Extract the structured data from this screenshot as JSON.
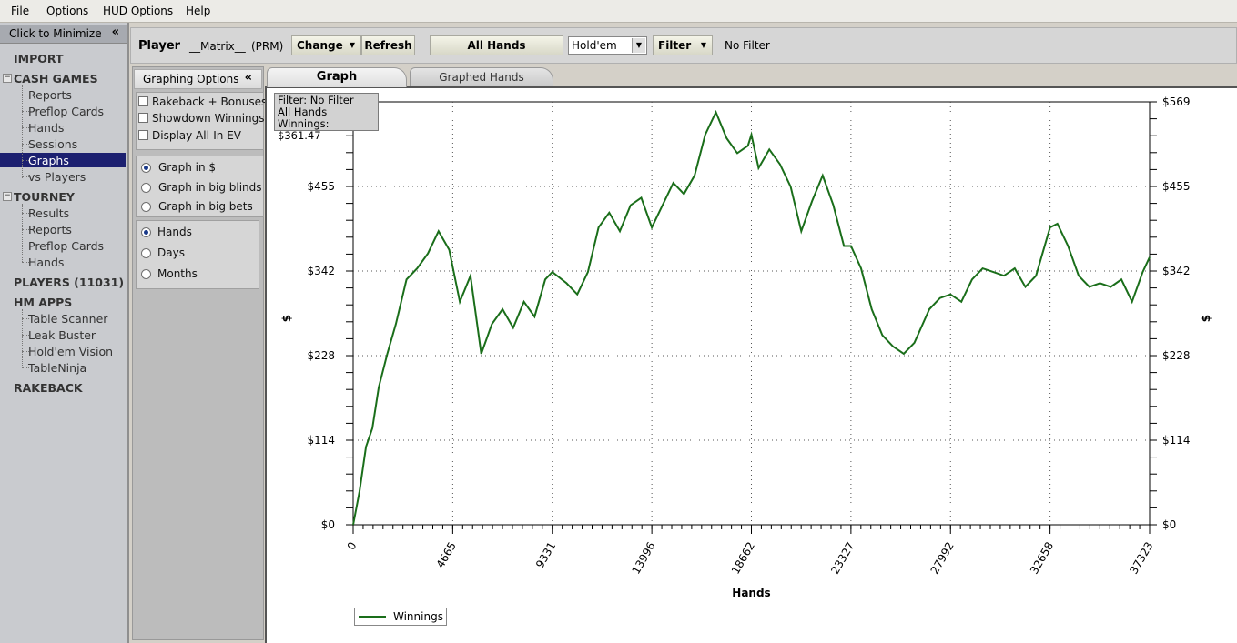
{
  "menu": [
    "File",
    "Options",
    "HUD Options",
    "Help"
  ],
  "sidebar": {
    "minimize_label": "Click to Minimize",
    "minimize_icon": "double-chevron-left-icon",
    "import": "IMPORT",
    "cash_games": {
      "label": "CASH GAMES",
      "items": [
        "Reports",
        "Preflop Cards",
        "Hands",
        "Sessions",
        "Graphs",
        "vs Players"
      ],
      "selected": "Graphs"
    },
    "tourney": {
      "label": "TOURNEY",
      "items": [
        "Results",
        "Reports",
        "Preflop Cards",
        "Hands"
      ]
    },
    "players": "PLAYERS (11031)",
    "hm_apps": {
      "label": "HM APPS",
      "items": [
        "Table Scanner",
        "Leak Buster",
        "Hold'em Vision",
        "TableNinja"
      ]
    },
    "rakeback": "RAKEBACK",
    "selection_color": "#1c2070"
  },
  "toolbar": {
    "player_label": "Player",
    "player_name": "__Matrix__",
    "player_site": "(PRM)",
    "change_label": "Change",
    "refresh_label": "Refresh",
    "all_hands_label": "All Hands",
    "game_select": "Hold'em",
    "filter_label": "Filter",
    "filter_status": "No Filter"
  },
  "options": {
    "title": "Graphing Options",
    "checkboxes": [
      {
        "label": "Rakeback + Bonuses",
        "checked": false
      },
      {
        "label": "Showdown Winnings",
        "checked": false
      },
      {
        "label": "Display All-In EV",
        "checked": false
      }
    ],
    "units": [
      {
        "label": "Graph in $",
        "selected": true
      },
      {
        "label": "Graph in big blinds",
        "selected": false
      },
      {
        "label": "Graph in big bets",
        "selected": false
      }
    ],
    "xaxis": [
      {
        "label": "Hands",
        "selected": true
      },
      {
        "label": "Days",
        "selected": false
      },
      {
        "label": "Months",
        "selected": false
      }
    ]
  },
  "tabs": [
    "Graph",
    "Graphed Hands"
  ],
  "active_tab": "Graph",
  "info_box": {
    "line1": "Filter: No Filter",
    "line2": "All Hands",
    "line3": "Winnings: $361.47"
  },
  "chart_data": {
    "type": "line",
    "xlabel": "Hands",
    "ylabel": "$",
    "xlim": [
      0,
      37323
    ],
    "ylim": [
      0,
      569
    ],
    "x_ticks": [
      "0",
      "4665",
      "9331",
      "13996",
      "18662",
      "23327",
      "27992",
      "32658",
      "37323"
    ],
    "y_ticks": [
      "$0",
      "$114",
      "$228",
      "$342",
      "$455",
      "$569"
    ],
    "grid": true,
    "legend": "bottom-left",
    "line_color": "#1a6e1a",
    "series": [
      {
        "name": "Winnings",
        "x": [
          0,
          300,
          600,
          900,
          1200,
          1600,
          2000,
          2500,
          3000,
          3500,
          4000,
          4500,
          5000,
          5500,
          6000,
          6500,
          7000,
          7500,
          8000,
          8500,
          9000,
          9331,
          10000,
          10500,
          11000,
          11500,
          12000,
          12500,
          13000,
          13500,
          13996,
          14500,
          15000,
          15500,
          16000,
          16500,
          17000,
          17500,
          18000,
          18500,
          18662,
          19000,
          19500,
          20000,
          20500,
          21000,
          21500,
          22000,
          22500,
          23000,
          23327,
          23800,
          24300,
          24800,
          25300,
          25800,
          26300,
          27000,
          27500,
          27992,
          28500,
          29000,
          29500,
          30000,
          30500,
          31000,
          31500,
          32000,
          32658,
          33000,
          33500,
          34000,
          34500,
          35000,
          35500,
          36000,
          36500,
          37000,
          37323
        ],
        "values": [
          0,
          45,
          105,
          130,
          185,
          230,
          270,
          330,
          345,
          365,
          395,
          370,
          300,
          335,
          230,
          270,
          290,
          265,
          300,
          280,
          330,
          340,
          325,
          310,
          340,
          400,
          420,
          395,
          430,
          440,
          400,
          430,
          460,
          445,
          470,
          525,
          555,
          520,
          500,
          510,
          525,
          480,
          505,
          485,
          455,
          395,
          435,
          470,
          430,
          375,
          375,
          345,
          290,
          255,
          240,
          230,
          245,
          290,
          305,
          310,
          300,
          330,
          345,
          340,
          335,
          345,
          320,
          335,
          400,
          405,
          375,
          335,
          320,
          325,
          320,
          330,
          300,
          340,
          360
        ]
      }
    ]
  }
}
